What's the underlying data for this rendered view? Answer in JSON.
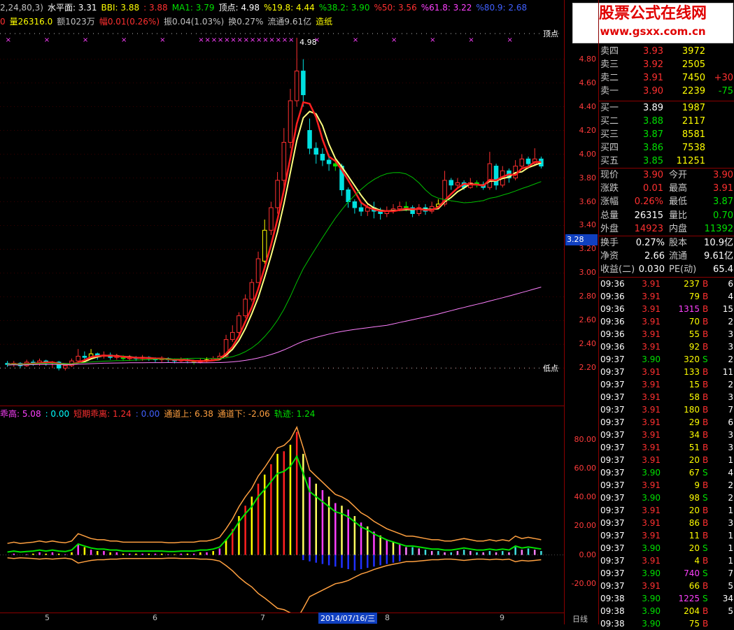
{
  "header_top": [
    {
      "text": "2,24,80,3)",
      "color": "#c0c0c0"
    },
    {
      "text": "水平面: 3.31",
      "color": "#ffffff"
    },
    {
      "text": "BBI: 3.88",
      "color": "#ffff00"
    },
    {
      "text": ": 3.88",
      "color": "#ff3030"
    },
    {
      "text": "MA1: 3.79",
      "color": "#00e000"
    },
    {
      "text": "顶点: 4.98",
      "color": "#ffffff"
    },
    {
      "text": "%19.8: 4.44",
      "color": "#ffff00"
    },
    {
      "text": "%38.2: 3.90",
      "color": "#00e000"
    },
    {
      "text": "%50: 3.56",
      "color": "#ff3030"
    },
    {
      "text": "%61.8: 3.22",
      "color": "#ff40ff"
    },
    {
      "text": "%80.9: 2.68",
      "color": "#4060ff"
    }
  ],
  "header_second": [
    {
      "text": "0",
      "color": "#ff3030"
    },
    {
      "text": "量26316.0",
      "color": "#ffff00"
    },
    {
      "text": "额1023万",
      "color": "#c0c0c0"
    },
    {
      "text": "幅0.01(0.26%)",
      "color": "#ff3030"
    },
    {
      "text": "振0.04(1.03%)",
      "color": "#c0c0c0"
    },
    {
      "text": "换0.27%",
      "color": "#c0c0c0"
    },
    {
      "text": "流通9.61亿",
      "color": "#c0c0c0"
    },
    {
      "text": "造纸",
      "color": "#ffff00"
    }
  ],
  "indicator_header": [
    {
      "text": "乖高: 5.08",
      "color": "#ff40ff"
    },
    {
      "text": ": 0.00",
      "color": "#00ffff"
    },
    {
      "text": "短期乖离: 1.24",
      "color": "#ff3030"
    },
    {
      "text": ": 0.00",
      "color": "#4060ff"
    },
    {
      "text": "通道上: 6.38",
      "color": "#ffa040"
    },
    {
      "text": "通道下: -2.06",
      "color": "#ffa040"
    },
    {
      "text": "轨迹: 1.24",
      "color": "#00e000"
    }
  ],
  "chart_labels": {
    "peak_label": "4.98",
    "top_point": "顶点",
    "low_point": "低点",
    "current_marker": "3.28",
    "date_cursor": "2014/07/16/三",
    "period": "日线"
  },
  "price_axis": [
    "4.80",
    "4.60",
    "4.40",
    "4.20",
    "4.00",
    "3.80",
    "3.60",
    "3.40",
    "3.20",
    "3.00",
    "2.80",
    "2.60",
    "2.40",
    "2.20"
  ],
  "indicator_axis": [
    "80.00",
    "60.00",
    "40.00",
    "20.00",
    "0.00",
    "-20.00"
  ],
  "month_ticks": [
    "5",
    "6",
    "7",
    "8",
    "9"
  ],
  "watermark": {
    "title": "股票公式在线网",
    "url": "www.gsxx.com.cn"
  },
  "sells": [
    {
      "label": "卖四",
      "price": "3.93",
      "vol": "3972",
      "chg": ""
    },
    {
      "label": "卖三",
      "price": "3.92",
      "vol": "2505",
      "chg": ""
    },
    {
      "label": "卖二",
      "price": "3.91",
      "vol": "7450",
      "chg": "+30"
    },
    {
      "label": "卖一",
      "price": "3.90",
      "vol": "2239",
      "chg": "-75"
    }
  ],
  "buys": [
    {
      "label": "买一",
      "price": "3.89",
      "vol": "1987"
    },
    {
      "label": "买二",
      "price": "3.88",
      "vol": "2117"
    },
    {
      "label": "买三",
      "price": "3.87",
      "vol": "8581"
    },
    {
      "label": "买四",
      "price": "3.86",
      "vol": "7538"
    },
    {
      "label": "买五",
      "price": "3.85",
      "vol": "11251"
    }
  ],
  "quote": [
    {
      "l1": "现价",
      "v1": "3.90",
      "c1": "#ff3030",
      "l2": "今开",
      "v2": "3.90",
      "c2": "#ff3030"
    },
    {
      "l1": "涨跌",
      "v1": "0.01",
      "c1": "#ff3030",
      "l2": "最高",
      "v2": "3.91",
      "c2": "#ff3030"
    },
    {
      "l1": "涨幅",
      "v1": "0.26%",
      "c1": "#ff3030",
      "l2": "最低",
      "v2": "3.87",
      "c2": "#00e000"
    },
    {
      "l1": "总量",
      "v1": "26315",
      "c1": "#ffffff",
      "l2": "量比",
      "v2": "0.70",
      "c2": "#00e000"
    },
    {
      "l1": "外盘",
      "v1": "14923",
      "c1": "#ff3030",
      "l2": "内盘",
      "v2": "11392",
      "c2": "#00e000"
    }
  ],
  "fundamentals": [
    {
      "l1": "换手",
      "v1": "0.27%",
      "l2": "股本",
      "v2": "10.9亿"
    },
    {
      "l1": "净资",
      "v1": "2.66",
      "l2": "流通",
      "v2": "9.61亿"
    },
    {
      "l1": "收益(二)",
      "v1": "0.030",
      "l2": "PE(动)",
      "v2": "65.4"
    }
  ],
  "ticks": [
    {
      "t": "09:36",
      "p": "3.91",
      "v": "237",
      "bs": "B",
      "n": "6"
    },
    {
      "t": "09:36",
      "p": "3.91",
      "v": "79",
      "bs": "B",
      "n": "4"
    },
    {
      "t": "09:36",
      "p": "3.91",
      "v": "1315",
      "bs": "B",
      "n": "15"
    },
    {
      "t": "09:36",
      "p": "3.91",
      "v": "70",
      "bs": "B",
      "n": "2"
    },
    {
      "t": "09:36",
      "p": "3.91",
      "v": "55",
      "bs": "B",
      "n": "3"
    },
    {
      "t": "09:36",
      "p": "3.91",
      "v": "92",
      "bs": "B",
      "n": "3"
    },
    {
      "t": "09:37",
      "p": "3.90",
      "v": "320",
      "bs": "S",
      "n": "2"
    },
    {
      "t": "09:37",
      "p": "3.91",
      "v": "133",
      "bs": "B",
      "n": "11"
    },
    {
      "t": "09:37",
      "p": "3.91",
      "v": "15",
      "bs": "B",
      "n": "2"
    },
    {
      "t": "09:37",
      "p": "3.91",
      "v": "58",
      "bs": "B",
      "n": "3"
    },
    {
      "t": "09:37",
      "p": "3.91",
      "v": "180",
      "bs": "B",
      "n": "7"
    },
    {
      "t": "09:37",
      "p": "3.91",
      "v": "29",
      "bs": "B",
      "n": "6"
    },
    {
      "t": "09:37",
      "p": "3.91",
      "v": "34",
      "bs": "B",
      "n": "3"
    },
    {
      "t": "09:37",
      "p": "3.91",
      "v": "51",
      "bs": "B",
      "n": "3"
    },
    {
      "t": "09:37",
      "p": "3.91",
      "v": "20",
      "bs": "B",
      "n": "1"
    },
    {
      "t": "09:37",
      "p": "3.90",
      "v": "67",
      "bs": "S",
      "n": "4"
    },
    {
      "t": "09:37",
      "p": "3.91",
      "v": "9",
      "bs": "B",
      "n": "2"
    },
    {
      "t": "09:37",
      "p": "3.90",
      "v": "98",
      "bs": "S",
      "n": "2"
    },
    {
      "t": "09:37",
      "p": "3.91",
      "v": "20",
      "bs": "B",
      "n": "1"
    },
    {
      "t": "09:37",
      "p": "3.91",
      "v": "86",
      "bs": "B",
      "n": "3"
    },
    {
      "t": "09:37",
      "p": "3.91",
      "v": "11",
      "bs": "B",
      "n": "1"
    },
    {
      "t": "09:37",
      "p": "3.90",
      "v": "20",
      "bs": "S",
      "n": "1"
    },
    {
      "t": "09:37",
      "p": "3.91",
      "v": "4",
      "bs": "B",
      "n": "1"
    },
    {
      "t": "09:37",
      "p": "3.90",
      "v": "740",
      "bs": "S",
      "n": "7"
    },
    {
      "t": "09:37",
      "p": "3.91",
      "v": "66",
      "bs": "B",
      "n": "5"
    },
    {
      "t": "09:38",
      "p": "3.90",
      "v": "1225",
      "bs": "S",
      "n": "34"
    },
    {
      "t": "09:38",
      "p": "3.90",
      "v": "204",
      "bs": "B",
      "n": "5"
    },
    {
      "t": "09:38",
      "p": "3.90",
      "v": "75",
      "bs": "B",
      "n": ""
    }
  ],
  "colors": {
    "up": "#ff3030",
    "down": "#00e000",
    "line_ma_slow": "#ff80ff",
    "line_ma_mid": "#00c000",
    "line_ma_fast": "#ffff80",
    "line_red": "#ff2020",
    "grid": "#8b0000"
  },
  "candles": [
    [
      2.24,
      2.23,
      2.26,
      2.21
    ],
    [
      2.23,
      2.24,
      2.26,
      2.21
    ],
    [
      2.24,
      2.22,
      2.25,
      2.2
    ],
    [
      2.22,
      2.25,
      2.27,
      2.21
    ],
    [
      2.25,
      2.24,
      2.27,
      2.22
    ],
    [
      2.24,
      2.26,
      2.28,
      2.22
    ],
    [
      2.26,
      2.24,
      2.27,
      2.22
    ],
    [
      2.24,
      2.25,
      2.26,
      2.2
    ],
    [
      2.25,
      2.2,
      2.26,
      2.18
    ],
    [
      2.2,
      2.22,
      2.24,
      2.18
    ],
    [
      2.22,
      2.26,
      2.28,
      2.21
    ],
    [
      2.26,
      2.3,
      2.36,
      2.25
    ],
    [
      2.3,
      2.29,
      2.34,
      2.27
    ],
    [
      2.29,
      2.32,
      2.36,
      2.28
    ],
    [
      2.32,
      2.3,
      2.33,
      2.27
    ],
    [
      2.3,
      2.31,
      2.34,
      2.28
    ],
    [
      2.31,
      2.29,
      2.33,
      2.27
    ],
    [
      2.29,
      2.3,
      2.32,
      2.27
    ],
    [
      2.3,
      2.28,
      2.31,
      2.26
    ],
    [
      2.28,
      2.29,
      2.31,
      2.26
    ],
    [
      2.29,
      2.28,
      2.3,
      2.26
    ],
    [
      2.28,
      2.29,
      2.31,
      2.26
    ],
    [
      2.29,
      2.28,
      2.3,
      2.26
    ],
    [
      2.28,
      2.27,
      2.29,
      2.25
    ],
    [
      2.27,
      2.28,
      2.3,
      2.25
    ],
    [
      2.28,
      2.27,
      2.29,
      2.25
    ],
    [
      2.27,
      2.26,
      2.28,
      2.24
    ],
    [
      2.26,
      2.27,
      2.29,
      2.25
    ],
    [
      2.27,
      2.26,
      2.28,
      2.24
    ],
    [
      2.26,
      2.25,
      2.27,
      2.23
    ],
    [
      2.25,
      2.26,
      2.28,
      2.24
    ],
    [
      2.26,
      2.27,
      2.29,
      2.25
    ],
    [
      2.27,
      2.28,
      2.3,
      2.26
    ],
    [
      2.28,
      2.3,
      2.33,
      2.27
    ],
    [
      2.3,
      2.44,
      2.48,
      2.29
    ],
    [
      2.44,
      2.5,
      2.56,
      2.42
    ],
    [
      2.5,
      2.64,
      2.67,
      2.48
    ],
    [
      2.64,
      2.78,
      2.82,
      2.62
    ],
    [
      2.78,
      2.92,
      2.95,
      2.76
    ],
    [
      2.92,
      3.12,
      3.18,
      2.92
    ],
    [
      3.1,
      3.36,
      3.45,
      3.08
    ],
    [
      3.36,
      3.55,
      3.6,
      3.32
    ],
    [
      3.55,
      3.78,
      3.85,
      3.5
    ],
    [
      3.78,
      4.1,
      4.22,
      3.72
    ],
    [
      4.1,
      4.45,
      4.55,
      4.05
    ],
    [
      4.45,
      4.7,
      4.98,
      4.4
    ],
    [
      4.7,
      4.5,
      4.8,
      4.4
    ],
    [
      4.2,
      4.05,
      4.3,
      4.0
    ],
    [
      4.05,
      4.0,
      4.1,
      3.92
    ],
    [
      4.0,
      3.95,
      4.05,
      3.9
    ],
    [
      3.95,
      3.92,
      4.0,
      3.86
    ],
    [
      3.92,
      3.9,
      3.96,
      3.86
    ],
    [
      3.9,
      3.7,
      3.92,
      3.65
    ],
    [
      3.7,
      3.6,
      3.72,
      3.55
    ],
    [
      3.6,
      3.55,
      3.62,
      3.5
    ],
    [
      3.55,
      3.52,
      3.6,
      3.48
    ],
    [
      3.52,
      3.55,
      3.58,
      3.48
    ],
    [
      3.55,
      3.52,
      3.6,
      3.46
    ],
    [
      3.52,
      3.5,
      3.55,
      3.45
    ],
    [
      3.5,
      3.52,
      3.56,
      3.47
    ],
    [
      3.52,
      3.54,
      3.58,
      3.5
    ],
    [
      3.54,
      3.56,
      3.6,
      3.52
    ],
    [
      3.56,
      3.55,
      3.6,
      3.52
    ],
    [
      3.55,
      3.5,
      3.57,
      3.47
    ],
    [
      3.5,
      3.55,
      3.58,
      3.48
    ],
    [
      3.55,
      3.52,
      3.58,
      3.49
    ],
    [
      3.52,
      3.56,
      3.6,
      3.5
    ],
    [
      3.56,
      3.58,
      3.62,
      3.54
    ],
    [
      3.58,
      3.78,
      3.86,
      3.56
    ],
    [
      3.78,
      3.74,
      3.8,
      3.7
    ],
    [
      3.74,
      3.76,
      3.8,
      3.72
    ],
    [
      3.76,
      3.72,
      3.78,
      3.7
    ],
    [
      3.72,
      3.76,
      3.8,
      3.71
    ],
    [
      3.76,
      3.74,
      3.78,
      3.72
    ],
    [
      3.74,
      3.72,
      3.77,
      3.7
    ],
    [
      3.72,
      3.92,
      4.02,
      3.7
    ],
    [
      3.9,
      3.74,
      3.92,
      3.7
    ],
    [
      3.74,
      3.86,
      3.9,
      3.72
    ],
    [
      3.86,
      3.8,
      3.88,
      3.76
    ],
    [
      3.8,
      3.9,
      3.95,
      3.78
    ],
    [
      3.9,
      3.96,
      4.0,
      3.88
    ],
    [
      3.96,
      3.92,
      3.98,
      3.88
    ],
    [
      3.92,
      3.96,
      4.05,
      3.9
    ],
    [
      3.96,
      3.9,
      3.98,
      3.88
    ]
  ],
  "indicator": [
    0,
    1,
    0,
    0.5,
    1,
    2,
    1,
    2,
    1,
    0.5,
    2,
    8,
    6,
    4,
    3,
    3,
    2,
    2,
    1,
    1,
    1,
    1,
    1,
    1,
    1,
    0.5,
    0.5,
    1,
    1,
    1,
    2,
    2,
    3,
    5,
    12,
    20,
    30,
    38,
    45,
    55,
    62,
    70,
    78,
    80,
    85,
    95,
    78,
    60,
    55,
    50,
    45,
    40,
    38,
    35,
    30,
    25,
    22,
    18,
    15,
    12,
    10,
    8,
    6,
    6,
    5,
    4,
    3,
    3,
    2,
    2,
    3,
    4,
    3,
    2,
    2,
    3,
    2,
    3,
    2,
    6,
    4,
    5,
    4,
    3
  ]
}
